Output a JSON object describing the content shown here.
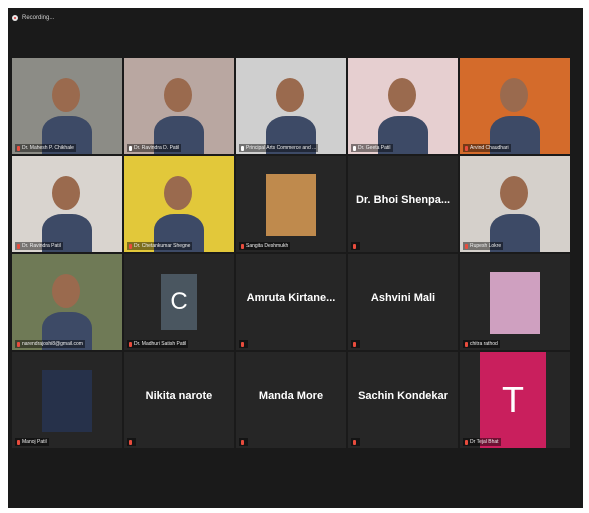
{
  "recording": {
    "label": "Recording..."
  },
  "tiles": [
    {
      "name": "Dr. Mahesh P. Chikhale",
      "muted": true,
      "type": "video",
      "bg": "#8c8c86"
    },
    {
      "name": "Dr. Ravindra D. Patil",
      "muted": false,
      "type": "video",
      "bg": "#b9a7a1"
    },
    {
      "name": "Principal Arts Commerce and ...",
      "muted": false,
      "type": "video",
      "bg": "#cfcfcf"
    },
    {
      "name": "Dr. Geeta Patil",
      "muted": false,
      "type": "video",
      "bg": "#e6cfd0",
      "active": true
    },
    {
      "name": "Arvind Chaudhari",
      "muted": true,
      "type": "video",
      "bg": "#d46b2b"
    },
    {
      "name": "Dr. Ravindra Patil",
      "muted": true,
      "type": "video",
      "bg": "#d9d4cf"
    },
    {
      "name": "Dr. Chetankumar Shegne",
      "muted": true,
      "type": "video",
      "bg": "#e2c83a"
    },
    {
      "name": "Sangita Deshmukh",
      "muted": true,
      "type": "image",
      "bg": "#bf8a4d"
    },
    {
      "name": "",
      "muted": true,
      "type": "text",
      "display": "Dr. Bhoi Shenpa..."
    },
    {
      "name": "Rupesh Lokre",
      "muted": true,
      "type": "video",
      "bg": "#d5d0cb"
    },
    {
      "name": "narendrajoshi8@gmail.com",
      "muted": true,
      "type": "video",
      "bg": "#6f7a56"
    },
    {
      "name": "Dr. Madhuri Satish Patil",
      "muted": true,
      "type": "avatar",
      "letter": "C",
      "avatar_color": "#4a5660"
    },
    {
      "name": "",
      "muted": true,
      "type": "text",
      "display": "Amruta Kirtane..."
    },
    {
      "name": "",
      "muted": true,
      "type": "text",
      "display": "Ashvini Mali"
    },
    {
      "name": "chitra rathod",
      "muted": true,
      "type": "image",
      "bg": "#cfa0c0"
    },
    {
      "name": "Manoj Patil",
      "muted": true,
      "type": "image",
      "bg": "#26314a"
    },
    {
      "name": "",
      "muted": true,
      "type": "text",
      "display": "Nikita narote"
    },
    {
      "name": "",
      "muted": true,
      "type": "text",
      "display": "Manda More"
    },
    {
      "name": "",
      "muted": true,
      "type": "text",
      "display": "Sachin Kondekar"
    },
    {
      "name": "Dr Tejal Bhat",
      "muted": true,
      "type": "avatar",
      "letter": "T",
      "avatar_color": "#c91f5d"
    }
  ]
}
